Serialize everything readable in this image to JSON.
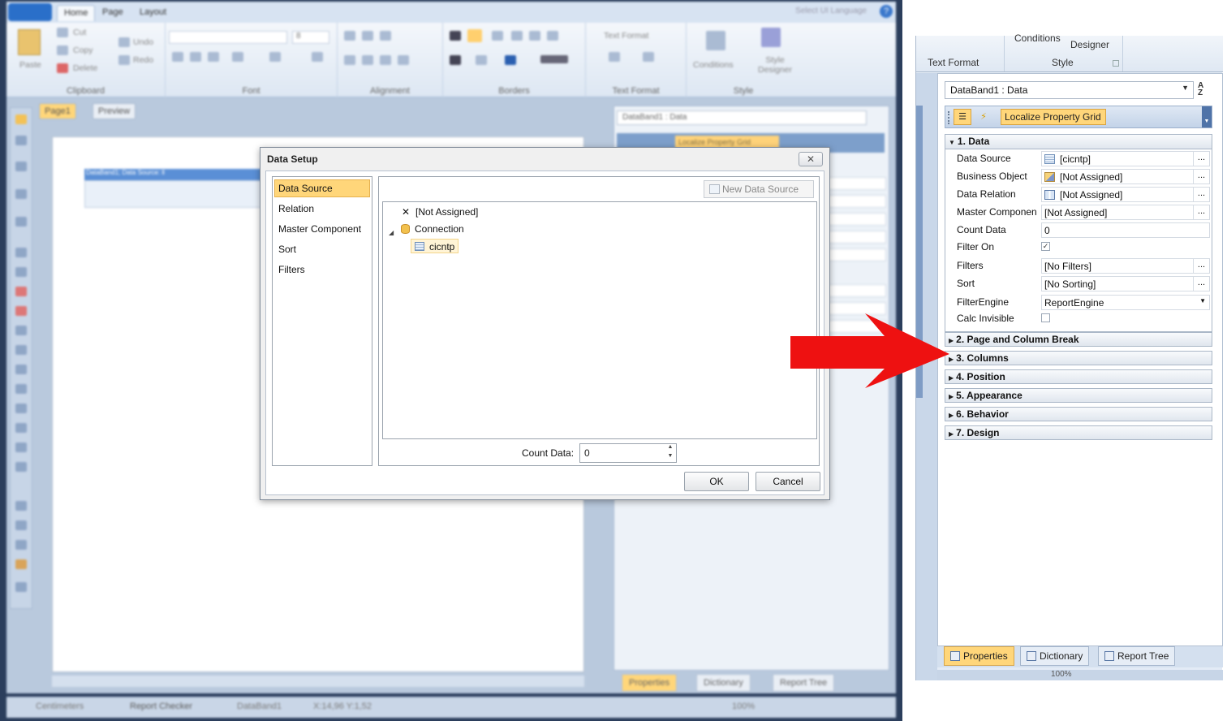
{
  "background_app": {
    "ribbon_tabs": [
      "Home",
      "Page",
      "Layout"
    ],
    "language_selector": "Select UI Language",
    "clipboard": {
      "paste": "Paste",
      "cut": "Cut",
      "copy": "Copy",
      "delete": "Delete"
    },
    "undo": "Undo",
    "redo": "Redo",
    "font_size": "8",
    "text_format_label": "Text Format",
    "conditions": "Conditions",
    "style_designer": "Style Designer",
    "group_labels": [
      "Clipboard",
      "Font",
      "Alignment",
      "Borders",
      "Text Format",
      "Style"
    ],
    "page_tabs": [
      "Page1",
      "Preview"
    ],
    "databand_label": "DataBand1; Data Source: ll",
    "prop_combo": "DataBand1 : Data",
    "localize_button": "Localize Property Grid",
    "bottom_tabs": [
      "Properties",
      "Dictionary",
      "Report Tree"
    ],
    "status": {
      "units": "Centimeters",
      "checker": "Report Checker",
      "component": "DataBand1",
      "coords": "X:14,96  Y:1,52",
      "zoom": "100%"
    }
  },
  "dialog": {
    "title": "Data Setup",
    "close_icon": "close-icon",
    "nav_items": [
      "Data Source",
      "Relation",
      "Master Component",
      "Sort",
      "Filters"
    ],
    "selected_nav": "Data Source",
    "new_data_source_button": "New Data Source",
    "tree": {
      "not_assigned": "[Not Assigned]",
      "connection": "Connection",
      "table": "cicntp"
    },
    "count_data_label": "Count Data:",
    "count_data_value": "0",
    "ok": "OK",
    "cancel": "Cancel"
  },
  "right_panel": {
    "ribbon": {
      "conditions": "Conditions",
      "designer": "Designer",
      "text_format": "Text Format",
      "style": "Style"
    },
    "combo_value": "DataBand1 : Data",
    "localize_button": "Localize Property Grid",
    "categories": [
      {
        "label": "1. Data",
        "expanded": true
      },
      {
        "label": "2. Page and Column Break",
        "expanded": false
      },
      {
        "label": "3. Columns",
        "expanded": false
      },
      {
        "label": "4. Position",
        "expanded": false
      },
      {
        "label": "5. Appearance",
        "expanded": false
      },
      {
        "label": "6. Behavior",
        "expanded": false
      },
      {
        "label": "7. Design",
        "expanded": false
      }
    ],
    "properties": [
      {
        "name": "Data Source",
        "value": "[cicntp]",
        "icon": "table-icon",
        "ellipsis": true
      },
      {
        "name": "Business Object",
        "value": "[Not Assigned]",
        "icon": "business-object-icon",
        "ellipsis": true
      },
      {
        "name": "Data Relation",
        "value": "[Not Assigned]",
        "icon": "relation-icon",
        "ellipsis": true
      },
      {
        "name": "Master Componen",
        "value": "[Not Assigned]",
        "ellipsis": true
      },
      {
        "name": "Count Data",
        "value": "0"
      },
      {
        "name": "Filter On",
        "checked": true
      },
      {
        "name": "Filters",
        "value": "[No Filters]",
        "ellipsis": true
      },
      {
        "name": "Sort",
        "value": "[No Sorting]",
        "ellipsis": true
      },
      {
        "name": "FilterEngine",
        "value": "ReportEngine",
        "dropdown": true
      },
      {
        "name": "Calc Invisible",
        "checked": false
      }
    ],
    "bottom_tabs": [
      "Properties",
      "Dictionary",
      "Report Tree"
    ],
    "active_tab": "Properties",
    "zoom": "100%"
  },
  "colors": {
    "arrow": "#ee1111",
    "highlight": "#ffd67a"
  }
}
